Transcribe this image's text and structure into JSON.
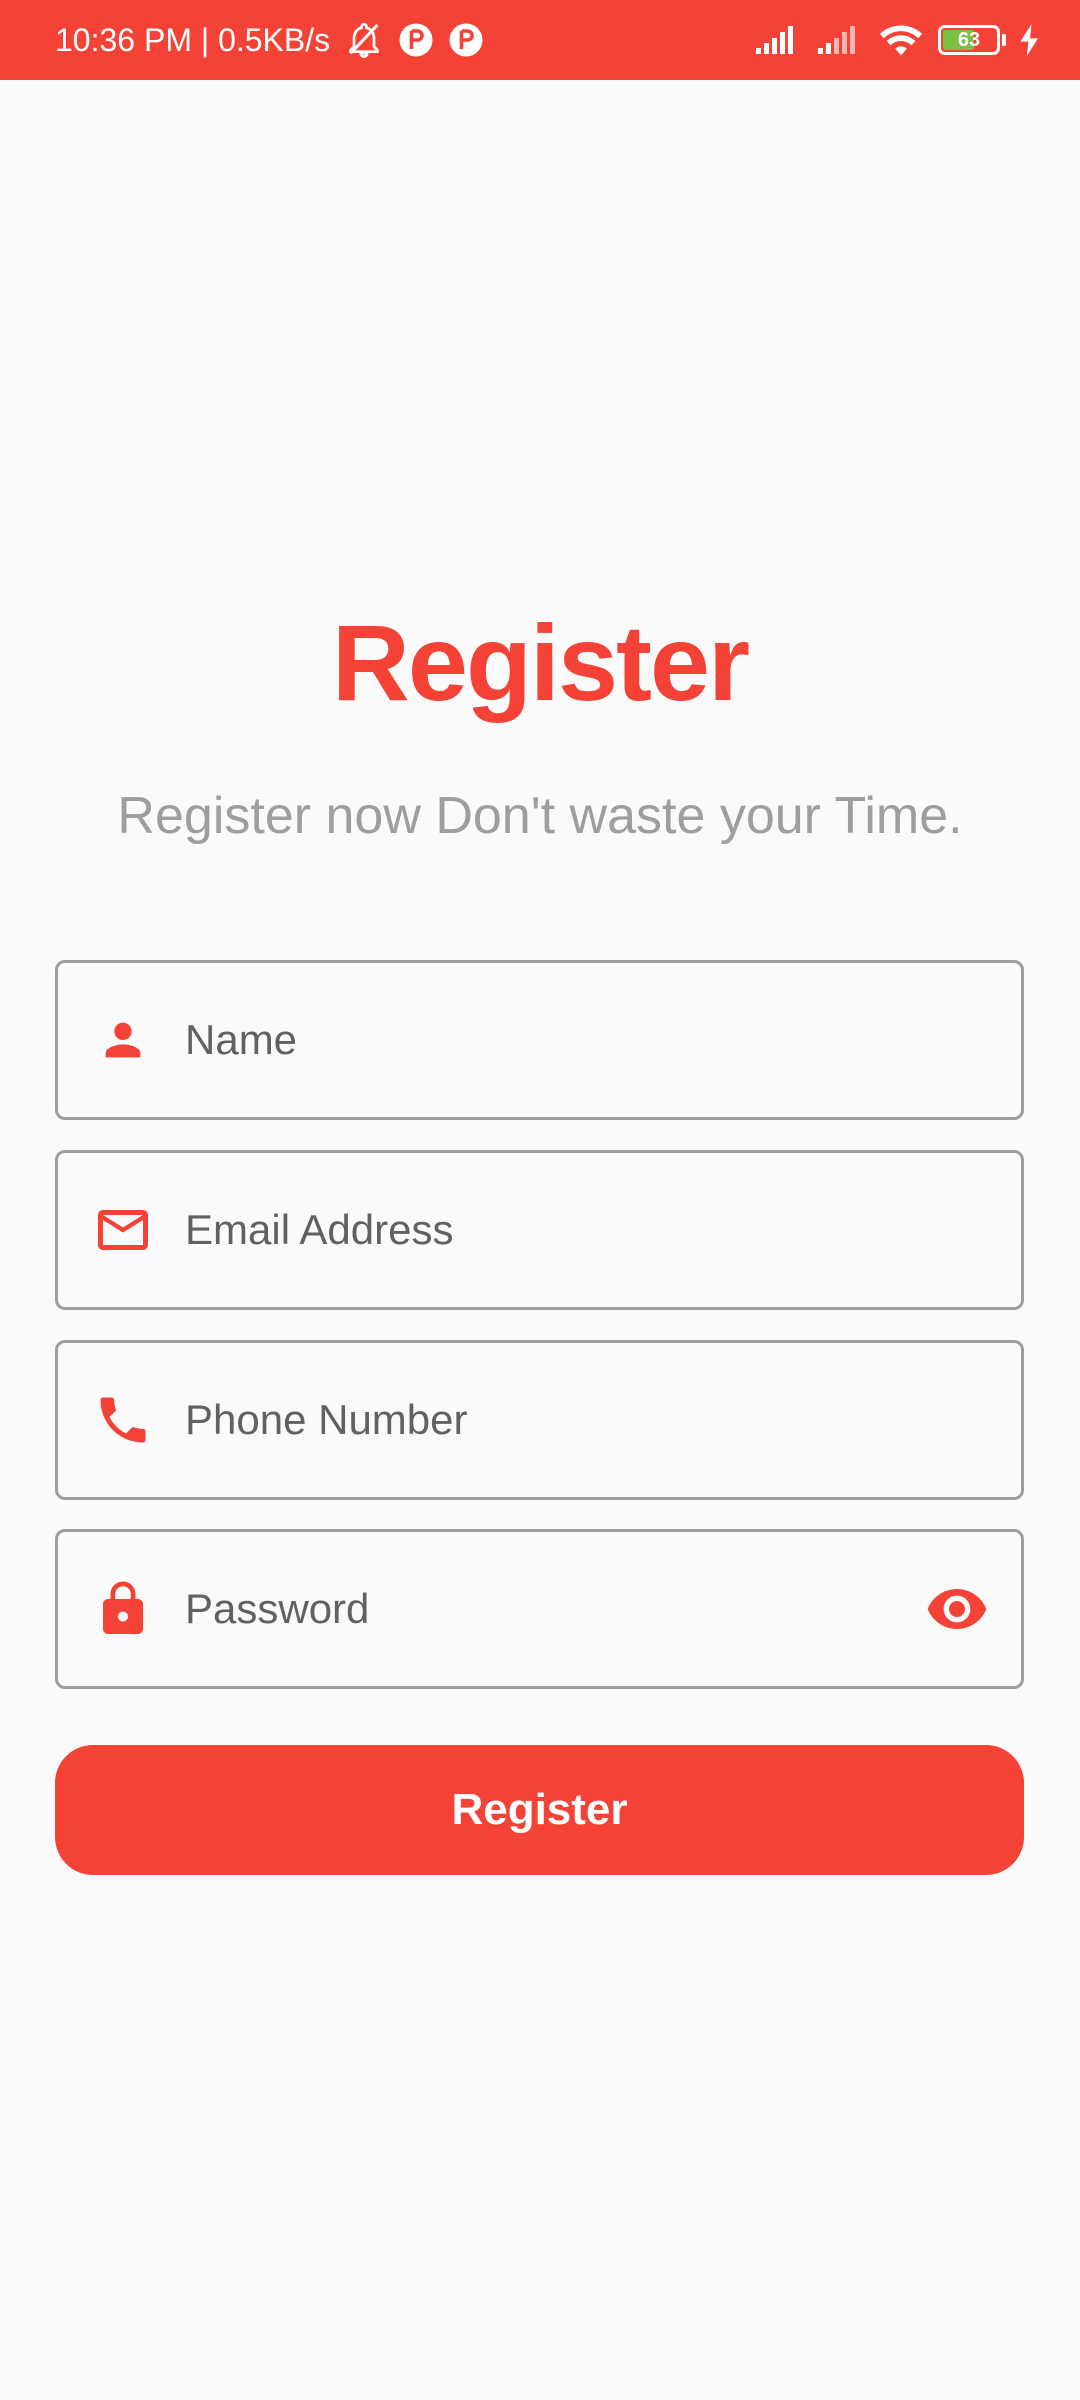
{
  "status_bar": {
    "time_speed": "10:36 PM | 0.5KB/s",
    "battery_level": "63",
    "battery_percent": 63,
    "icons": [
      "mute-bell-icon",
      "app-notification-icon",
      "app-notification-icon",
      "signal-icon",
      "signal-icon",
      "wifi-icon",
      "battery-icon",
      "charging-icon"
    ]
  },
  "page": {
    "title": "Register",
    "subtitle": "Register now Don't waste your Time."
  },
  "form": {
    "name": {
      "placeholder": "Name",
      "icon": "person-icon"
    },
    "email": {
      "placeholder": "Email Address",
      "icon": "mail-icon"
    },
    "phone": {
      "placeholder": "Phone Number",
      "icon": "phone-icon"
    },
    "password": {
      "placeholder": "Password",
      "icon": "lock-icon",
      "trailing_icon": "eye-icon"
    },
    "submit_label": "Register"
  },
  "colors": {
    "accent": "#f44336",
    "background": "#fafafa",
    "border": "#9e9e9e",
    "subtitle": "#9e9e9e",
    "battery_fill": "#7bc043"
  }
}
